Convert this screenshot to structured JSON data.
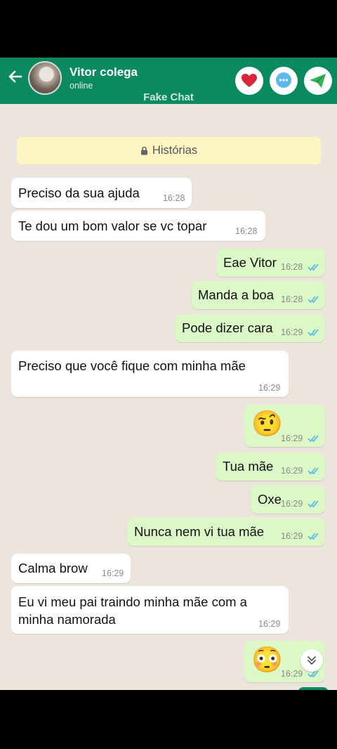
{
  "header": {
    "contact_name": "Vitor colega",
    "status": "online",
    "app_label": "Fake Chat",
    "back_icon": "arrow-left-icon",
    "buttons": [
      "heart-icon",
      "chat-bubble-icon",
      "paper-plane-icon"
    ]
  },
  "chat": {
    "stories_label": "Histórias",
    "messages": [
      {
        "text": "Preciso da sua ajuda",
        "time": "16:28",
        "dir": "in"
      },
      {
        "text": "Te dou um bom valor se vc topar",
        "time": "16:28",
        "dir": "in"
      },
      {
        "text": "Eae Vitor",
        "time": "16:28",
        "dir": "out"
      },
      {
        "text": "Manda a boa",
        "time": "16:28",
        "dir": "out"
      },
      {
        "text": "Pode dizer cara",
        "time": "16:29",
        "dir": "out"
      },
      {
        "text": "Preciso que você fique com minha mãe",
        "time": "16:29",
        "dir": "in"
      },
      {
        "text": "🤨",
        "time": "16:29",
        "dir": "out"
      },
      {
        "text": "Tua mãe",
        "time": "16:29",
        "dir": "out"
      },
      {
        "text": "Oxe",
        "time": "16:29",
        "dir": "out"
      },
      {
        "text": "Nunca nem vi tua mãe",
        "time": "16:29",
        "dir": "out"
      },
      {
        "text": "Calma brow",
        "time": "16:29",
        "dir": "in"
      },
      {
        "text": "Eu vi meu pai traindo minha mãe com a minha namorada",
        "time": "16:29",
        "dir": "in"
      },
      {
        "text": "😳",
        "time": "16:29",
        "dir": "out"
      }
    ]
  },
  "colors": {
    "header": "#0b8a61",
    "outgoing": "#dcf8c6",
    "incoming": "#ffffff",
    "chat_bg": "#ece5dd",
    "read_ticks": "#4fb6ec"
  }
}
